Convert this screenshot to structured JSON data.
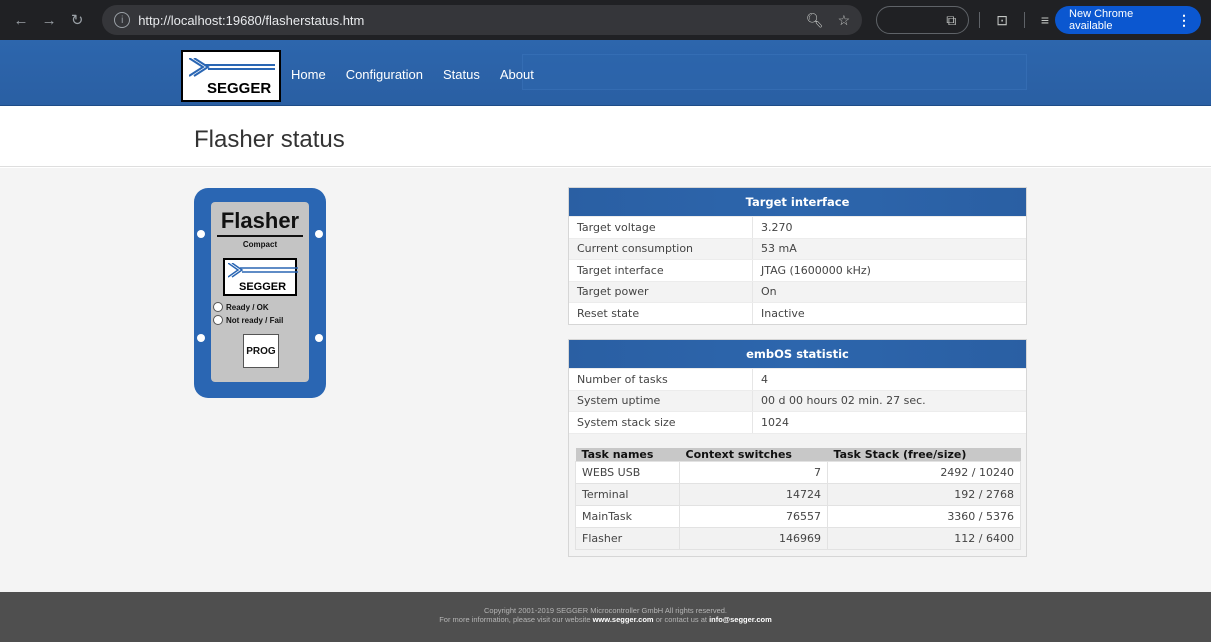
{
  "browser": {
    "url": "http://localhost:19680/flasherstatus.htm",
    "update_label": "New Chrome available"
  },
  "header": {
    "logo_text": "SEGGER",
    "nav": [
      "Home",
      "Configuration",
      "Status",
      "About"
    ]
  },
  "page": {
    "title": "Flasher status"
  },
  "device": {
    "title": "Flasher",
    "subtitle": "Compact",
    "logo_text": "SEGGER",
    "led_ready": "Ready / OK",
    "led_not_ready": "Not ready / Fail",
    "prog_label": "PROG"
  },
  "target_interface": {
    "heading": "Target interface",
    "rows": [
      {
        "key": "Target voltage",
        "value": "3.270"
      },
      {
        "key": "Current consumption",
        "value": "53 mA"
      },
      {
        "key": "Target interface",
        "value": "JTAG (1600000 kHz)"
      },
      {
        "key": "Target power",
        "value": "On"
      },
      {
        "key": "Reset state",
        "value": "Inactive"
      }
    ]
  },
  "embos": {
    "heading": "embOS statistic",
    "rows": [
      {
        "key": "Number of tasks",
        "value": "4"
      },
      {
        "key": "System uptime",
        "value": "00 d 00 hours 02 min. 27 sec."
      },
      {
        "key": "System stack size",
        "value": "1024"
      }
    ],
    "task_headers": [
      "Task names",
      "Context switches",
      "Task Stack (free/size)"
    ],
    "tasks": [
      {
        "name": "WEBS USB",
        "switches": "7",
        "stack": "2492 / 10240"
      },
      {
        "name": "Terminal",
        "switches": "14724",
        "stack": "192 / 2768"
      },
      {
        "name": "MainTask",
        "switches": "76557",
        "stack": "3360 / 5376"
      },
      {
        "name": "Flasher",
        "switches": "146969",
        "stack": "112 / 6400"
      }
    ]
  },
  "footer": {
    "line1": "Copyright 2001-2019 SEGGER Microcontroller GmbH All rights reserved.",
    "line2_pre": "For more information, please visit our website",
    "website": "www.segger.com",
    "line2_mid": "or contact us at",
    "email": "info@segger.com"
  }
}
